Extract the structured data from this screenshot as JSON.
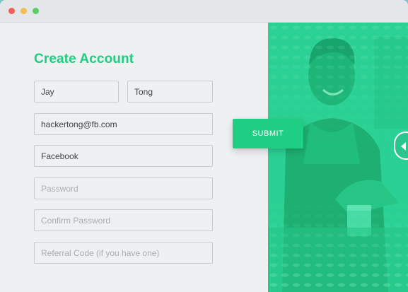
{
  "form": {
    "title": "Create Account",
    "first_name": "Jay",
    "last_name": "Tong",
    "email": "hackertong@fb.com",
    "company": "Facebook",
    "password_placeholder": "Password",
    "confirm_password_placeholder": "Confirm Password",
    "referral_placeholder": "Referral Code (if you have one)",
    "submit_label": "SUBMIT"
  },
  "colors": {
    "accent": "#1fce82",
    "overlay": "#2fd59a"
  },
  "icons": {
    "window_close": "red-dot",
    "window_minimize": "yellow-dot",
    "window_maximize": "green-dot",
    "slider": "chevron-left-icon"
  }
}
